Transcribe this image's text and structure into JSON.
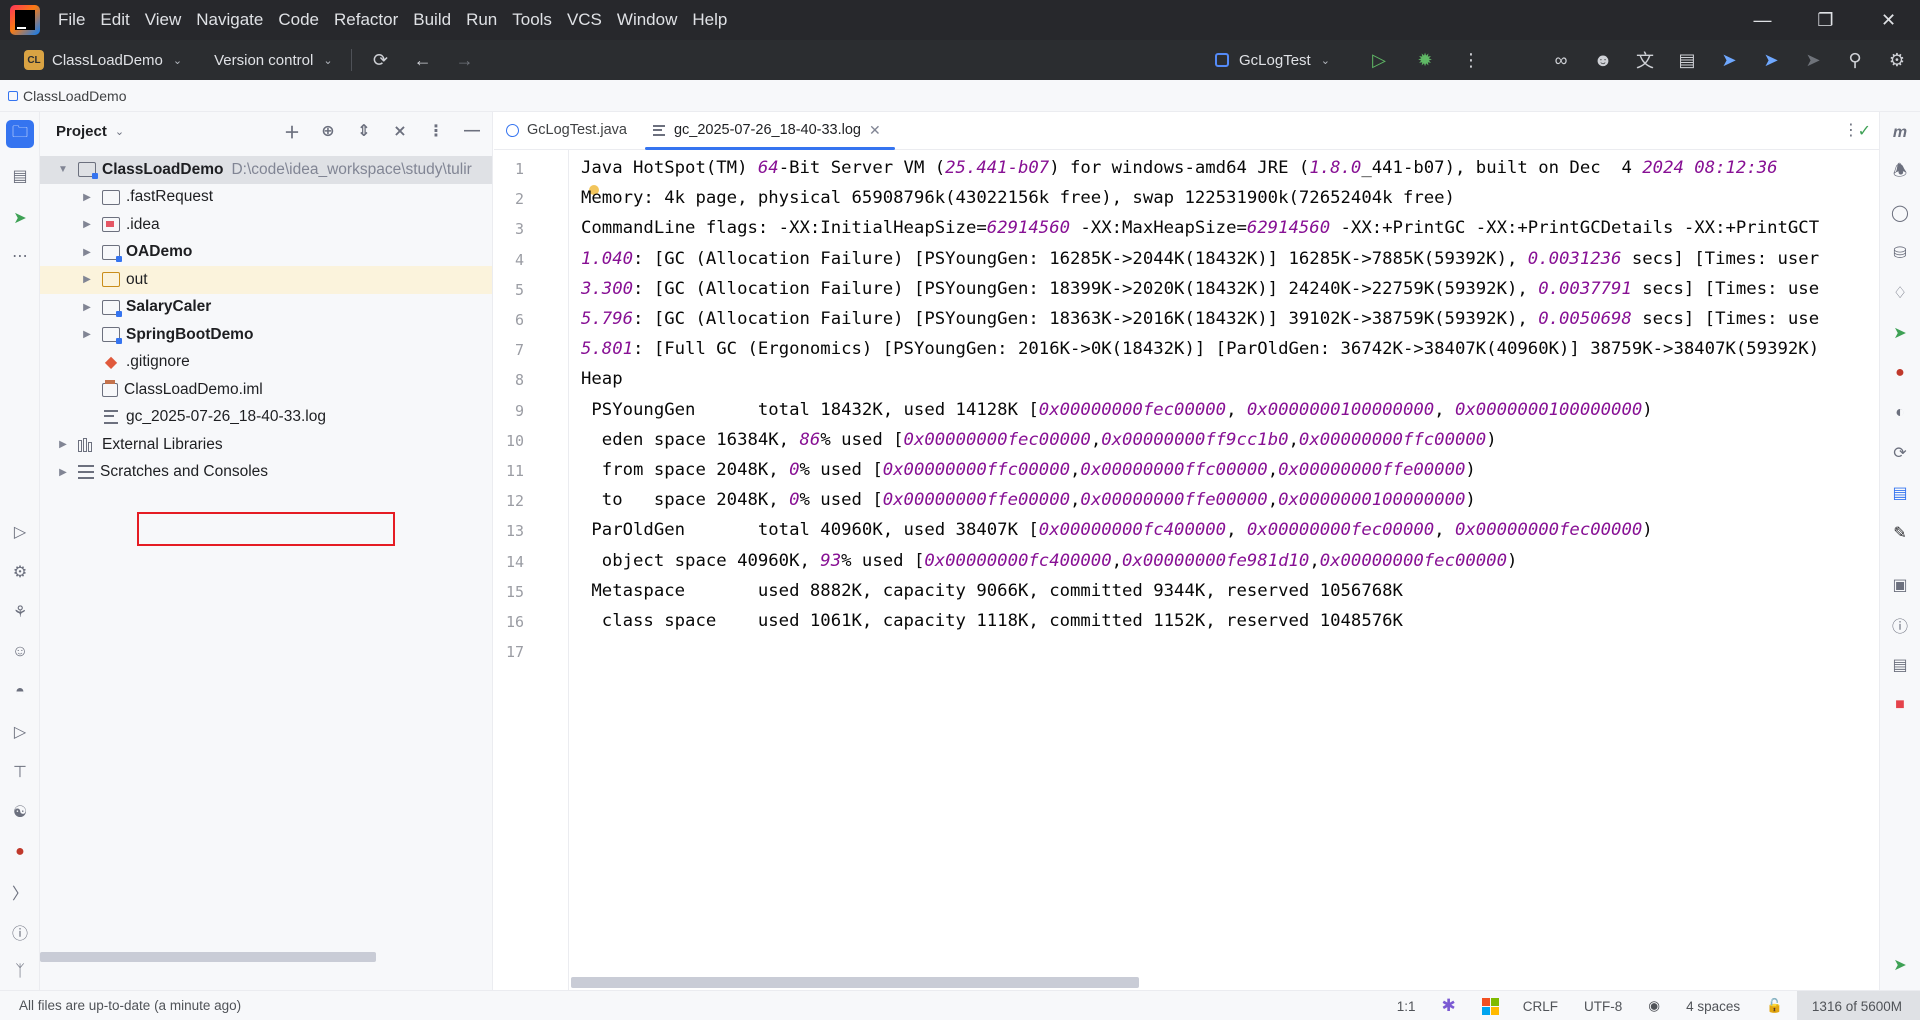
{
  "menubar": {
    "items": [
      "File",
      "Edit",
      "View",
      "Navigate",
      "Code",
      "Refactor",
      "Build",
      "Run",
      "Tools",
      "VCS",
      "Window",
      "Help"
    ]
  },
  "toolbar": {
    "project_badge": "CL",
    "project_name": "ClassLoadDemo",
    "version_control": "Version control",
    "run_config": "GcLogTest"
  },
  "breadcrumb": {
    "project": "ClassLoadDemo"
  },
  "project_panel": {
    "title": "Project",
    "root_name": "ClassLoadDemo",
    "root_path": "D:\\code\\idea_workspace\\study\\tulir",
    "items": [
      ".fastRequest",
      ".idea",
      "OADemo",
      "out",
      "SalaryCaler",
      "SpringBootDemo",
      ".gitignore",
      "ClassLoadDemo.iml",
      "gc_2025-07-26_18-40-33.log",
      "External Libraries",
      "Scratches and Consoles"
    ]
  },
  "editor": {
    "tabs": [
      "GcLogTest.java",
      "gc_2025-07-26_18-40-33.log"
    ],
    "line_numbers": [
      "1",
      "2",
      "3",
      "4",
      "5",
      "6",
      "7",
      "8",
      "9",
      "10",
      "11",
      "12",
      "13",
      "14",
      "15",
      "16",
      "17"
    ],
    "lines": [
      "Java HotSpot(TM) 64-Bit Server VM (25.441-b07) for windows-amd64 JRE (1.8.0_441-b07), built on Dec  4 2024 08:12:36",
      "Memory: 4k page, physical 65908796k(43022156k free), swap 122531900k(72652404k free)",
      "CommandLine flags: -XX:InitialHeapSize=62914560 -XX:MaxHeapSize=62914560 -XX:+PrintGC -XX:+PrintGCDetails -XX:+PrintGCT",
      "1.040: [GC (Allocation Failure) [PSYoungGen: 16285K->2044K(18432K)] 16285K->7885K(59392K), 0.0031236 secs] [Times: user",
      "3.300: [GC (Allocation Failure) [PSYoungGen: 18399K->2020K(18432K)] 24240K->22759K(59392K), 0.0037791 secs] [Times: use",
      "5.796: [GC (Allocation Failure) [PSYoungGen: 18363K->2016K(18432K)] 39102K->38759K(59392K), 0.0050698 secs] [Times: use",
      "5.801: [Full GC (Ergonomics) [PSYoungGen: 2016K->0K(18432K)] [ParOldGen: 36742K->38407K(40960K)] 38759K->38407K(59392K)",
      "Heap",
      " PSYoungGen      total 18432K, used 14128K [0x00000000fec00000, 0x0000000100000000, 0x0000000100000000)",
      "  eden space 16384K, 86% used [0x00000000fec00000,0x00000000ff9cc1b0,0x00000000ffc00000)",
      "  from space 2048K, 0% used [0x00000000ffc00000,0x00000000ffc00000,0x00000000ffe00000)",
      "  to   space 2048K, 0% used [0x00000000ffe00000,0x00000000ffe00000,0x0000000100000000)",
      " ParOldGen       total 40960K, used 38407K [0x00000000fc400000, 0x00000000fec00000, 0x00000000fec00000)",
      "  object space 40960K, 93% used [0x00000000fc400000,0x00000000fe981d10,0x00000000fec00000)",
      " Metaspace       used 8882K, capacity 9066K, committed 9344K, reserved 1056768K",
      "  class space    used 1061K, capacity 1118K, committed 1152K, reserved 1048576K",
      ""
    ]
  },
  "statusbar": {
    "message": "All files are up-to-date (a minute ago)",
    "position": "1:1",
    "line_separator": "CRLF",
    "encoding": "UTF-8",
    "indent": "4 spaces",
    "memory": "1316 of 5600M"
  },
  "colors": {
    "accent": "#3574f0",
    "numeric_literal": "#871094",
    "highlight_box": "#e51c23",
    "menubar_bg": "#27282c",
    "toolbar_bg": "#2b2d30"
  }
}
